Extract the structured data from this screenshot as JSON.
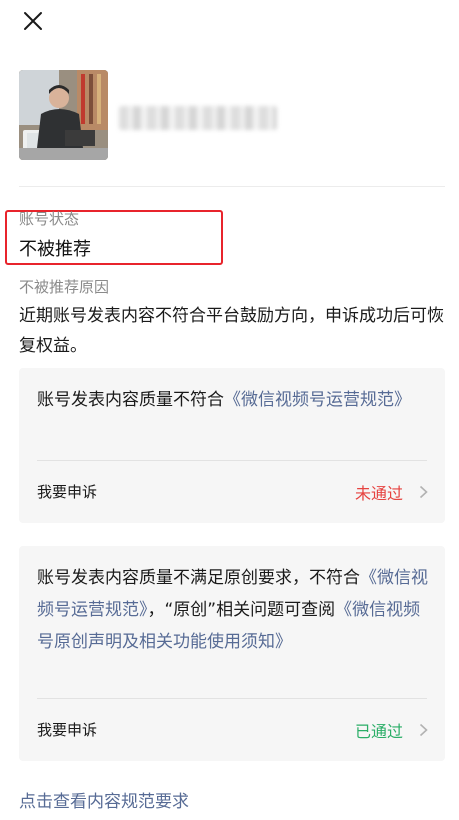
{
  "header": {
    "close_icon": "close-icon"
  },
  "profile": {
    "avatar_icon": "avatar"
  },
  "status": {
    "label": "账号状态",
    "value": "不被推荐",
    "highlight_color": "#e8242c"
  },
  "reason": {
    "label": "不被推荐原因",
    "text": "近期账号发表内容不符合平台鼓励方向，申诉成功后可恢复权益。"
  },
  "cards": [
    {
      "text_before": "账号发表内容质量不符合",
      "link": "《微信视频号运营规范》",
      "appeal_label": "我要申诉",
      "appeal_status": "未通过",
      "status_color": "#e64340"
    },
    {
      "text_before": "账号发表内容质量不满足原创要求，不符合",
      "link": "《微信视频号运营规范》",
      "text_middle": "，“原创”相关问题可查阅",
      "link2": "《微信视频号原创声明及相关功能使用须知》",
      "appeal_label": "我要申诉",
      "appeal_status": "已通过",
      "status_color": "#2aae67"
    }
  ],
  "footer": {
    "link": "点击查看内容规范要求"
  },
  "colors": {
    "link": "#576b95",
    "text": "#1a1a1a",
    "muted": "#8a8a8a"
  }
}
